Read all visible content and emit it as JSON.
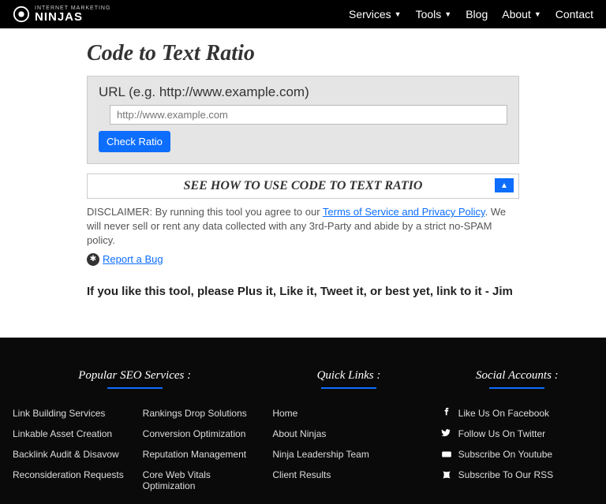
{
  "nav": {
    "brand_top": "INTERNET MARKETING",
    "brand_main": "NINJAS",
    "items": [
      "Services",
      "Tools",
      "Blog",
      "About",
      "Contact"
    ],
    "dropdown": [
      true,
      true,
      false,
      true,
      false
    ]
  },
  "page": {
    "title": "Code to Text Ratio",
    "url_label": "URL (e.g. http://www.example.com)",
    "url_placeholder": "http://www.example.com",
    "check_btn": "Check Ratio",
    "howto": "SEE HOW TO USE CODE TO TEXT RATIO",
    "disclaimer_a": "DISCLAIMER: By running this tool you agree to our ",
    "terms_link": "Terms of Service and Privacy Policy",
    "disclaimer_b": ". We will never sell or rent any data collected with any 3rd-Party and abide by a strict no-SPAM policy.",
    "report_bug": "Report a Bug",
    "cta": "If you like this tool, please Plus it, Like it, Tweet it, or best yet, link to it - Jim"
  },
  "footer": {
    "col1": {
      "title": "Popular SEO Services :",
      "left": [
        "Link Building Services",
        "Linkable Asset Creation",
        "Backlink Audit & Disavow",
        "Reconsideration Requests"
      ],
      "right": [
        "Rankings Drop Solutions",
        "Conversion Optimization",
        "Reputation Management",
        "Core Web Vitals Optimization"
      ]
    },
    "col2": {
      "title": "Quick Links :",
      "items": [
        "Home",
        "About Ninjas",
        "Ninja Leadership Team",
        "Client Results"
      ]
    },
    "col3": {
      "title": "Social Accounts :",
      "items": [
        "Like Us On Facebook",
        "Follow Us On Twitter",
        "Subscribe On Youtube",
        "Subscribe To Our RSS"
      ]
    }
  }
}
